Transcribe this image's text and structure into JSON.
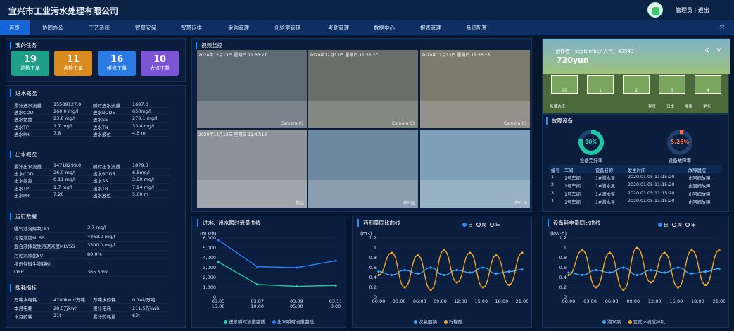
{
  "header": {
    "title": "宜兴市工业污水处理有限公司",
    "user": "管理员 | 退出"
  },
  "nav": [
    "首页",
    "协同办公",
    "工艺系统",
    "智慧安保",
    "智慧运维",
    "采购管理",
    "化验室管理",
    "考勤管理",
    "数据中心",
    "报表管理",
    "系统配置"
  ],
  "tasks": {
    "title": "我的任务",
    "cards": [
      {
        "value": "19",
        "label": "巡检工单",
        "color": "#1e9f8a"
      },
      {
        "value": "11",
        "label": "点检工单",
        "color": "#d98b1f"
      },
      {
        "value": "16",
        "label": "维修工单",
        "color": "#2c7be5"
      },
      {
        "value": "10",
        "label": "大修工单",
        "color": "#7b55d6"
      }
    ]
  },
  "inflow": {
    "title": "进水概况",
    "rows": [
      [
        "累计进水流量",
        "15589127.0",
        "瞬时进水流量",
        "1697.0"
      ],
      [
        "进水COD",
        "260.0 mg/l",
        "进水BOD5",
        "650mg/l"
      ],
      [
        "进水氨氮",
        "23.8 mg/l",
        "进水SS",
        "270.1 mg/l"
      ],
      [
        "进水TP",
        "1.7 mg/l",
        "进水TN",
        "33.4 mg/l"
      ],
      [
        "进水PH",
        "7.8",
        "进水液位",
        "4.5 m"
      ]
    ]
  },
  "outflow": {
    "title": "出水概况",
    "rows": [
      [
        "累计出水流量",
        "14718299.0",
        "瞬时出水流量",
        "1879.3"
      ],
      [
        "出水COD",
        "26.0 mg/l",
        "出水BOD5",
        "6.5mg/l"
      ],
      [
        "出水氨氮",
        "0.11 mg/l",
        "出水SS",
        "2.90 mg/l"
      ],
      [
        "出水TP",
        "1.7 mg/l",
        "出水TN",
        "7.94 mg/l"
      ],
      [
        "出水PH",
        "7.20",
        "出水液位",
        "5.00 m"
      ]
    ]
  },
  "operation": {
    "title": "运行数据",
    "rows": [
      [
        "曝气池溶解氧DO",
        "3.7 mg/l"
      ],
      [
        "污泥浓度MLSS",
        "4863.0 mg/l"
      ],
      [
        "混合液挥发性污泥浓度MLVSS",
        "3500.0 mg/l"
      ],
      [
        "污泥沉降比SV",
        "80.0%"
      ],
      [
        "指示性微生物镜检",
        "--"
      ],
      [
        "ORP",
        "365.5mv"
      ]
    ]
  },
  "energy": {
    "title": "能耗指标",
    "rows": [
      [
        "万吨水电耗",
        "4700kwh/万吨",
        "万吨水药耗",
        "0.14t/万吨"
      ],
      [
        "本月电耗",
        "28.5万kwh",
        "累计电耗",
        "211.5万kwh"
      ],
      [
        "本月药耗",
        "21t",
        "累计药耗量",
        "63t"
      ]
    ]
  },
  "video": {
    "title": "视频监控",
    "cams": [
      {
        "label": "2020年12月13日 星期日 11:33:27",
        "foot": "Camera 01",
        "bg": "#5e6a73"
      },
      {
        "label": "2020年12月13日 星期日 11:33:27",
        "foot": "Camera 01",
        "bg": "#6a6e68"
      },
      {
        "label": "2020年12月13日 星期日 11:33:25",
        "foot": "Camera 01",
        "bg": "#7d7a6e"
      },
      {
        "label": "2020年12月13日 星期日 11:47:12",
        "foot": "扬尘",
        "bg": "#8c949a"
      },
      {
        "label": "",
        "foot": "办公区",
        "bg": "#6f8aa0"
      },
      {
        "label": "",
        "foot": "停车场",
        "bg": "#7fa0b8"
      }
    ]
  },
  "vr": {
    "author": "创作者：september",
    "popularity": "人气：43543",
    "logo": "720yun",
    "thumbs": [
      "00",
      "1",
      "2",
      "3",
      "4"
    ],
    "bottom": [
      "场景选择",
      "导览",
      "日本",
      "搜索",
      "更多"
    ]
  },
  "faults": {
    "title": "故障设备",
    "gauges": [
      {
        "value": "80%",
        "label": "设备完好率",
        "color": "#1fc8a6",
        "pct": 80
      },
      {
        "value": "5.26%",
        "label": "设备故障率",
        "color": "#ff6b4a",
        "pct": 5.26
      }
    ],
    "headers": [
      "编号",
      "车间",
      "设备名称",
      "发生时间",
      "故障属况"
    ],
    "rows": [
      [
        "1",
        "1号车间",
        "1#潜水泵",
        "2020.01.05 11:15:20",
        "止回阀故障"
      ],
      [
        "2",
        "1号车间",
        "1#潜水泵",
        "2020.01.05 11:15:20",
        "止回阀故障"
      ],
      [
        "3",
        "1号车间",
        "1#潜水泵",
        "2020.01.05 11:15:20",
        "止回阀故障"
      ],
      [
        "4",
        "1号车间",
        "1#潜水泵",
        "2020.01.05 11:15:20",
        "止回阀故障"
      ]
    ]
  },
  "chart1_title": "进水、出水瞬时流量曲线",
  "chart2_title": "药剂量同比曲线",
  "chart3_title": "设备耗电量同比曲线",
  "period_options": [
    "日",
    "周",
    "年"
  ],
  "chart_data": [
    {
      "type": "line",
      "title": "进水、出水瞬时流量曲线",
      "ylabel": "(m3/h)",
      "x": [
        "03.05\n15:00",
        "03.07\n10:00",
        "03.09\n05:00",
        "03.11\n0:00"
      ],
      "ylim": [
        0,
        6000
      ],
      "yticks": [
        "0",
        "1,000",
        "2,000",
        "3,000",
        "4,000",
        "5,000",
        "6,000"
      ],
      "series": [
        {
          "name": "进水瞬时流量曲线",
          "color": "#1fd1a0",
          "values": [
            3600,
            1300,
            1100,
            1200
          ]
        },
        {
          "name": "出水瞬时流量曲线",
          "color": "#2d7cff",
          "values": [
            5800,
            3100,
            3000,
            3700
          ]
        }
      ]
    },
    {
      "type": "line",
      "title": "药剂量同比曲线",
      "ylabel": "(m3)",
      "x": [
        "00:00",
        "03:00",
        "06:00",
        "09:00",
        "12:00",
        "15:00",
        "18:00",
        "21:00"
      ],
      "ylim": [
        0,
        1.2
      ],
      "yticks": [
        "0",
        "0.2",
        "0.4",
        "0.6",
        "0.8",
        "1",
        "1.2"
      ],
      "series": [
        {
          "name": "次氯酸钠",
          "color": "#3aa4ff",
          "values": [
            0.52,
            0.45,
            0.55,
            0.48,
            0.6,
            0.45,
            0.55,
            0.5,
            0.6,
            0.48,
            0.52,
            0.56
          ]
        },
        {
          "name": "柠檬酸",
          "color": "#f5a623",
          "values": [
            0.45,
            0.9,
            0.2,
            0.85,
            0.15,
            0.95,
            0.3,
            0.9,
            0.2,
            0.85,
            0.25,
            0.9
          ]
        }
      ]
    },
    {
      "type": "line",
      "title": "设备耗电量同比曲线",
      "ylabel": "(kW·h)",
      "x": [
        "00:00",
        "03:00",
        "06:00",
        "09:00",
        "12:00",
        "15:00",
        "18:00",
        "21:00"
      ],
      "ylim": [
        0,
        1.2
      ],
      "yticks": [
        "0",
        "0.2",
        "0.4",
        "0.6",
        "0.8",
        "1",
        "1.2"
      ],
      "series": [
        {
          "name": "潜水泵",
          "color": "#3aa4ff",
          "values": [
            0.5,
            0.45,
            0.55,
            0.5,
            0.6,
            0.45,
            0.55,
            0.5,
            0.6,
            0.48,
            0.52,
            0.58
          ]
        },
        {
          "name": "立式环流搅拌机",
          "color": "#f5a623",
          "values": [
            0.45,
            0.95,
            0.2,
            0.9,
            0.15,
            1.0,
            0.3,
            0.9,
            0.2,
            0.95,
            0.25,
            0.95
          ]
        }
      ]
    }
  ]
}
